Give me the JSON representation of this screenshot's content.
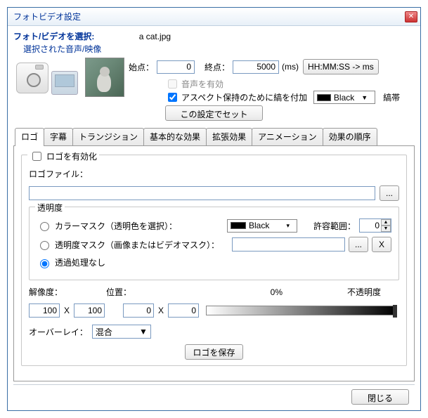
{
  "window": {
    "title": "フォトビデオ設定"
  },
  "header": {
    "select_label": "フォト/ビデオを選択:",
    "selected_sub": "選択された音声/映像",
    "filename": "a cat.jpg"
  },
  "time": {
    "start_label": "始点：",
    "start_value": "0",
    "end_label": "終点：",
    "end_value": "5000",
    "ms_label": "(ms)",
    "convert_btn": "HH:MM:SS -> ms"
  },
  "options": {
    "audio_enable": "音声を有効",
    "aspect_border": "アスペクト保持のために縞を付加",
    "color_label": "Black",
    "stripe_label": "縞帯",
    "set_btn": "この設定でセット"
  },
  "tabs": {
    "logo": "ロゴ",
    "subtitle": "字幕",
    "transition": "トランジション",
    "basic_fx": "基本的な効果",
    "ext_fx": "拡張効果",
    "animation": "アニメーション",
    "fx_order": "効果の順序"
  },
  "logo": {
    "enable": "ロゴを有効化",
    "file_label": "ロゴファイル：",
    "browse": "...",
    "transparency_group": "透明度",
    "color_mask": "カラーマスク（透明色を選択）：",
    "color_mask_val": "Black",
    "tolerance_label": "許容範囲：",
    "tolerance_val": "0",
    "alpha_mask": "透明度マスク（画像またはビデオマスク）：",
    "alpha_browse": "...",
    "alpha_clear": "X",
    "none": "透過処理なし",
    "resolution_label": "解像度：",
    "res_w": "100",
    "res_h": "100",
    "position_label": "位置：",
    "pos_x": "0",
    "pos_y": "0",
    "opacity_zero": "0%",
    "opacity_label": "不透明度",
    "overlay_label": "オーバーレイ：",
    "overlay_mode": "混合",
    "save_btn": "ロゴを保存"
  },
  "footer": {
    "close": "閉じる"
  }
}
